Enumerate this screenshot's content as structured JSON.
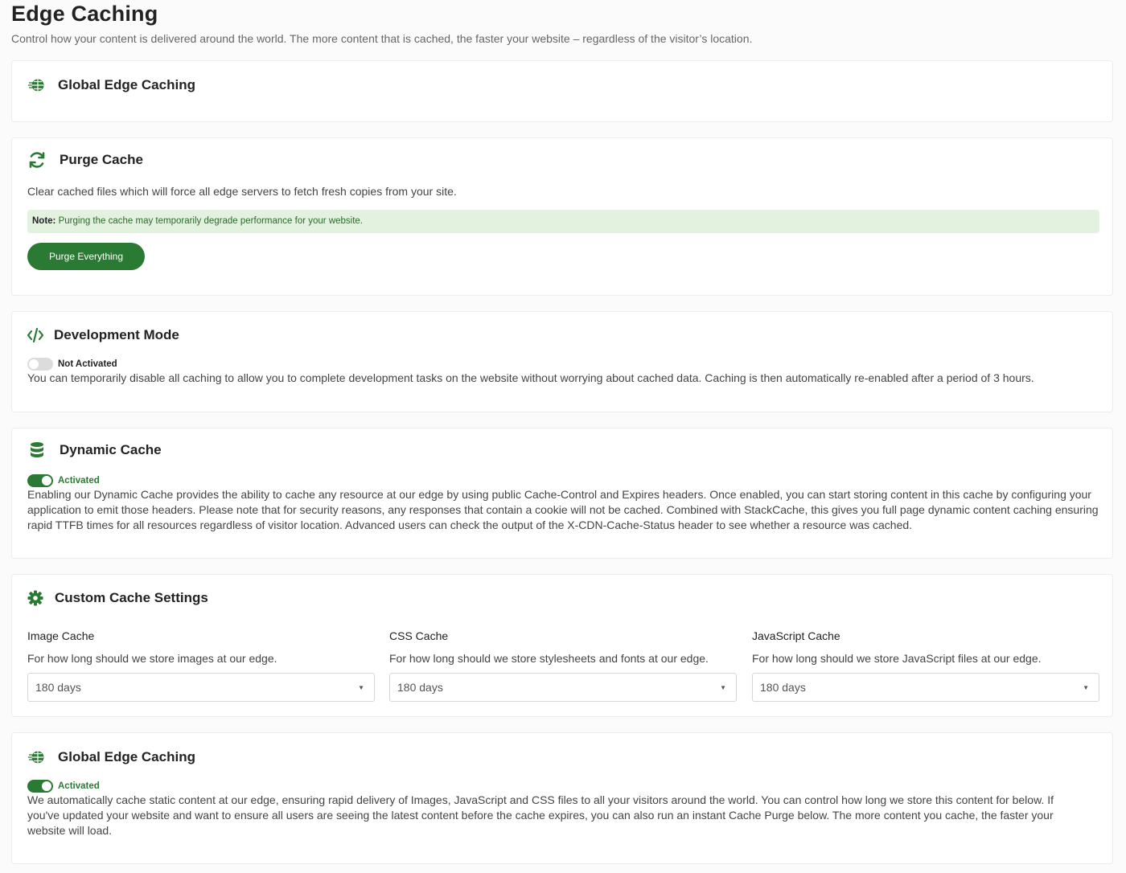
{
  "page": {
    "title": "Edge Caching",
    "subtitle": "Control how your content is delivered around the world. The more content that is cached, the faster your website – regardless of the visitor’s location."
  },
  "colors": {
    "accent": "#2a7a33",
    "note_bg": "#e3f2df",
    "toggle_off": "#dcdcdc"
  },
  "cards": {
    "global_top": {
      "title": "Global Edge Caching",
      "icon": "globe-icon"
    },
    "purge": {
      "title": "Purge Cache",
      "icon": "refresh-icon",
      "description": "Clear cached files which will force all edge servers to fetch fresh copies from your site.",
      "note_label": "Note:",
      "note_text": "Purging the cache may temporarily degrade performance for your website.",
      "button_label": "Purge Everything"
    },
    "dev": {
      "title": "Development Mode",
      "icon": "code-icon",
      "toggle_state": "off",
      "status": "Not Activated",
      "description": "You can temporarily disable all caching to allow you to complete development tasks on the website without worrying about cached data. Caching is then automatically re-enabled after a period of 3 hours."
    },
    "dynamic": {
      "title": "Dynamic Cache",
      "icon": "database-icon",
      "toggle_state": "on",
      "status": "Activated",
      "description": "Enabling our Dynamic Cache provides the ability to cache any resource at our edge by using public Cache-Control and Expires headers. Once enabled, you can start storing content in this cache by configuring your application to emit those headers. Please note that for security reasons, any responses that contain a cookie will not be cached. Combined with StackCache, this gives you full page dynamic content caching ensuring rapid TTFB times for all resources regardless of visitor location. Advanced users can check the output of the X-CDN-Cache-Status header to see whether a resource was cached."
    },
    "custom": {
      "title": "Custom Cache Settings",
      "icon": "gear-icon",
      "columns": [
        {
          "title": "Image Cache",
          "description": "For how long should we store images at our edge.",
          "value": "180 days"
        },
        {
          "title": "CSS Cache",
          "description": "For how long should we store stylesheets and fonts at our edge.",
          "value": "180 days"
        },
        {
          "title": "JavaScript Cache",
          "description": "For how long should we store JavaScript files at our edge.",
          "value": "180 days"
        }
      ]
    },
    "global_bottom": {
      "title": "Global Edge Caching",
      "icon": "globe-icon",
      "toggle_state": "on",
      "status": "Activated",
      "description": "We automatically cache static content at our edge, ensuring rapid delivery of Images, JavaScript and CSS files to all your visitors around the world. You can control how long we store this content for below. If you've updated your website and want to ensure all users are seeing the latest content before the cache expires, you can also run an instant Cache Purge below. The more content you cache, the faster your website will load."
    }
  }
}
